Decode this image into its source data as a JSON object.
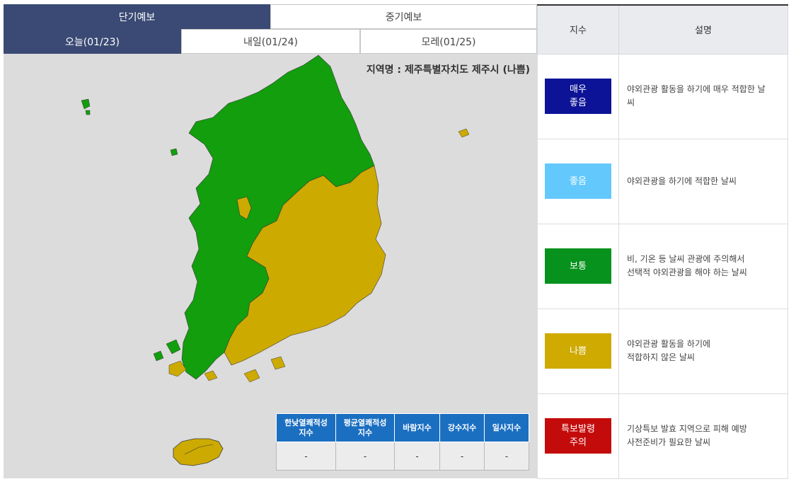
{
  "tabs": {
    "main": [
      {
        "label": "단기예보",
        "active": true
      },
      {
        "label": "중기예보",
        "active": false
      }
    ],
    "days": [
      {
        "label": "오늘(01/23)",
        "active": true
      },
      {
        "label": "내일(01/24)",
        "active": false
      },
      {
        "label": "모레(01/25)",
        "active": false
      }
    ]
  },
  "map": {
    "region_label": "지역명 : 제주특별자치도 제주시 (나쁨)",
    "colors": {
      "green_region": "#129e0d",
      "yellow_region": "#cdaa00",
      "background": "#dcdcdc",
      "border": "#555555"
    }
  },
  "indices_table": {
    "headers": [
      "한낮열쾌적성\n지수",
      "평균열쾌적성\n지수",
      "바람지수",
      "강수지수",
      "일사지수"
    ],
    "values": [
      "-",
      "-",
      "-",
      "-",
      "-"
    ]
  },
  "legend": {
    "headers": {
      "index": "지수",
      "desc": "설명"
    },
    "rows": [
      {
        "label": "매우\n좋음",
        "color": "#0d1396",
        "desc": "야외관광 활동을 하기에 매우 적합한 날\n씨"
      },
      {
        "label": "좋음",
        "color": "#63c9fc",
        "desc": "야외관광을 하기에 적합한 날씨"
      },
      {
        "label": "보통",
        "color": "#06921c",
        "desc": "비, 기온 등 날씨 관광에 주의해서\n선택적 야외관광을 해야 하는 날씨"
      },
      {
        "label": "나쁨",
        "color": "#cfaa00",
        "desc": "야외관광 활동을 하기에\n적합하지 않은 날씨"
      },
      {
        "label": "특보발령\n주의",
        "color": "#c40b0b",
        "desc": "기상특보 발효 지역으로 피해 예방\n사전준비가 필요한 날씨"
      }
    ]
  }
}
